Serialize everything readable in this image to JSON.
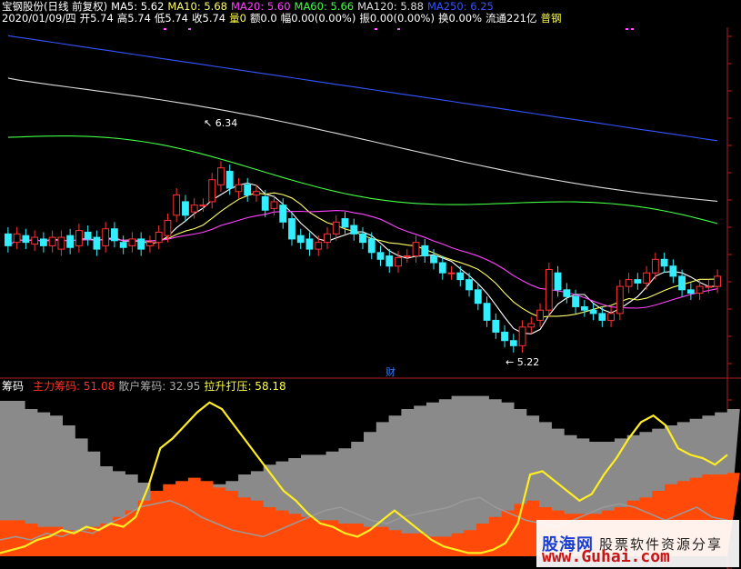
{
  "header": {
    "stock": {
      "text": "宝钢股份(日线 前复权)",
      "color": "#ffffff"
    },
    "ma": [
      {
        "label": "MA5: 5.62",
        "color": "#ffffff"
      },
      {
        "label": "MA10: 5.68",
        "color": "#ffff66"
      },
      {
        "label": "MA20: 5.60",
        "color": "#ff44ff"
      },
      {
        "label": "MA60: 5.66",
        "color": "#44ff44"
      },
      {
        "label": "MA120: 5.88",
        "color": "#dddddd"
      },
      {
        "label": "MA250: 6.25",
        "color": "#3355ff"
      }
    ]
  },
  "quote": {
    "items": [
      {
        "label": "2020/01/09/四",
        "color": "#ffffff"
      },
      {
        "label": "开5.74",
        "color": "#ffffff"
      },
      {
        "label": "高5.74",
        "color": "#ffffff"
      },
      {
        "label": "低5.74",
        "color": "#ffffff"
      },
      {
        "label": "收5.74",
        "color": "#ffffff"
      },
      {
        "label": "量0",
        "color": "#ffff44"
      },
      {
        "label": "额0.0",
        "color": "#ffffff"
      },
      {
        "label": "幅0.00(0.00%)",
        "color": "#ffffff"
      },
      {
        "label": "振0.00(0.00%)",
        "color": "#ffffff"
      },
      {
        "label": "换0.00%",
        "color": "#ffffff"
      },
      {
        "label": "流通221亿",
        "color": "#ffffff"
      },
      {
        "label": "普钢",
        "color": "#ffff44"
      }
    ]
  },
  "annotations": {
    "high": "6.34",
    "low": "5.22",
    "marker": "财"
  },
  "indicator": {
    "name": {
      "text": "筹码",
      "color": "#ffffff"
    },
    "items": [
      {
        "label": "主力筹码: 51.08",
        "color": "#ff3322"
      },
      {
        "label": "散户筹码: 32.95",
        "color": "#aaaaaa"
      },
      {
        "label": "拉升打压: 58.18",
        "color": "#ffff44"
      }
    ]
  },
  "chart_data": {
    "type": "candlestick",
    "price_range": [
      5.1,
      7.15
    ],
    "up_color": "#ff3333",
    "down_color": "#33eeff",
    "candles": [
      {
        "o": 5.93,
        "c": 5.86
      },
      {
        "o": 5.88,
        "c": 5.93
      },
      {
        "o": 5.92,
        "c": 5.88
      },
      {
        "o": 5.87,
        "c": 5.91
      },
      {
        "o": 5.9,
        "c": 5.86
      },
      {
        "o": 5.86,
        "c": 5.91
      },
      {
        "o": 5.84,
        "c": 5.91
      },
      {
        "o": 5.92,
        "c": 5.85
      },
      {
        "o": 5.86,
        "c": 5.95
      },
      {
        "o": 5.94,
        "c": 5.9
      },
      {
        "o": 5.91,
        "c": 5.84
      },
      {
        "o": 5.86,
        "c": 5.96
      },
      {
        "o": 5.96,
        "c": 5.89
      },
      {
        "o": 5.88,
        "c": 5.85
      },
      {
        "o": 5.86,
        "c": 5.9
      },
      {
        "o": 5.9,
        "c": 5.84
      },
      {
        "o": 5.86,
        "c": 5.88
      },
      {
        "o": 5.88,
        "c": 5.94
      },
      {
        "o": 5.92,
        "c": 6.01
      },
      {
        "o": 6.04,
        "c": 6.16
      },
      {
        "o": 6.12,
        "c": 6.04
      },
      {
        "o": 6.06,
        "c": 6.1
      },
      {
        "o": 6.1,
        "c": 6.1
      },
      {
        "o": 6.12,
        "c": 6.25
      },
      {
        "o": 6.22,
        "c": 6.32
      },
      {
        "o": 6.3,
        "c": 6.2
      },
      {
        "o": 6.18,
        "c": 6.22
      },
      {
        "o": 6.22,
        "c": 6.16
      },
      {
        "o": 6.16,
        "c": 6.18
      },
      {
        "o": 6.15,
        "c": 6.07
      },
      {
        "o": 6.08,
        "c": 6.12
      },
      {
        "o": 6.1,
        "c": 6.0
      },
      {
        "o": 6.02,
        "c": 5.9
      },
      {
        "o": 5.92,
        "c": 5.88
      },
      {
        "o": 5.9,
        "c": 5.84
      },
      {
        "o": 5.84,
        "c": 5.88
      },
      {
        "o": 5.88,
        "c": 5.93
      },
      {
        "o": 5.93,
        "c": 6.0
      },
      {
        "o": 6.02,
        "c": 5.97
      },
      {
        "o": 5.98,
        "c": 5.93
      },
      {
        "o": 5.93,
        "c": 5.88
      },
      {
        "o": 5.9,
        "c": 5.82
      },
      {
        "o": 5.82,
        "c": 5.78
      },
      {
        "o": 5.8,
        "c": 5.74
      },
      {
        "o": 5.74,
        "c": 5.79
      },
      {
        "o": 5.8,
        "c": 5.8
      },
      {
        "o": 5.8,
        "c": 5.88
      },
      {
        "o": 5.86,
        "c": 5.8
      },
      {
        "o": 5.8,
        "c": 5.76
      },
      {
        "o": 5.76,
        "c": 5.7
      },
      {
        "o": 5.7,
        "c": 5.7
      },
      {
        "o": 5.7,
        "c": 5.66
      },
      {
        "o": 5.66,
        "c": 5.6
      },
      {
        "o": 5.6,
        "c": 5.52
      },
      {
        "o": 5.52,
        "c": 5.42
      },
      {
        "o": 5.42,
        "c": 5.35
      },
      {
        "o": 5.35,
        "c": 5.3
      },
      {
        "o": 5.3,
        "c": 5.27
      },
      {
        "o": 5.27,
        "c": 5.38
      },
      {
        "o": 5.38,
        "c": 5.4
      },
      {
        "o": 5.42,
        "c": 5.48
      },
      {
        "o": 5.48,
        "c": 5.72
      },
      {
        "o": 5.7,
        "c": 5.6
      },
      {
        "o": 5.6,
        "c": 5.56
      },
      {
        "o": 5.56,
        "c": 5.5
      },
      {
        "o": 5.5,
        "c": 5.48
      },
      {
        "o": 5.48,
        "c": 5.46
      },
      {
        "o": 5.46,
        "c": 5.42
      },
      {
        "o": 5.42,
        "c": 5.46
      },
      {
        "o": 5.46,
        "c": 5.62
      },
      {
        "o": 5.62,
        "c": 5.66
      },
      {
        "o": 5.66,
        "c": 5.64
      },
      {
        "o": 5.64,
        "c": 5.7
      },
      {
        "o": 5.7,
        "c": 5.78
      },
      {
        "o": 5.78,
        "c": 5.74
      },
      {
        "o": 5.74,
        "c": 5.68
      },
      {
        "o": 5.68,
        "c": 5.6
      },
      {
        "o": 5.6,
        "c": 5.58
      },
      {
        "o": 5.58,
        "c": 5.62
      },
      {
        "o": 5.62,
        "c": 5.62
      },
      {
        "o": 5.62,
        "c": 5.68
      }
    ]
  }
}
